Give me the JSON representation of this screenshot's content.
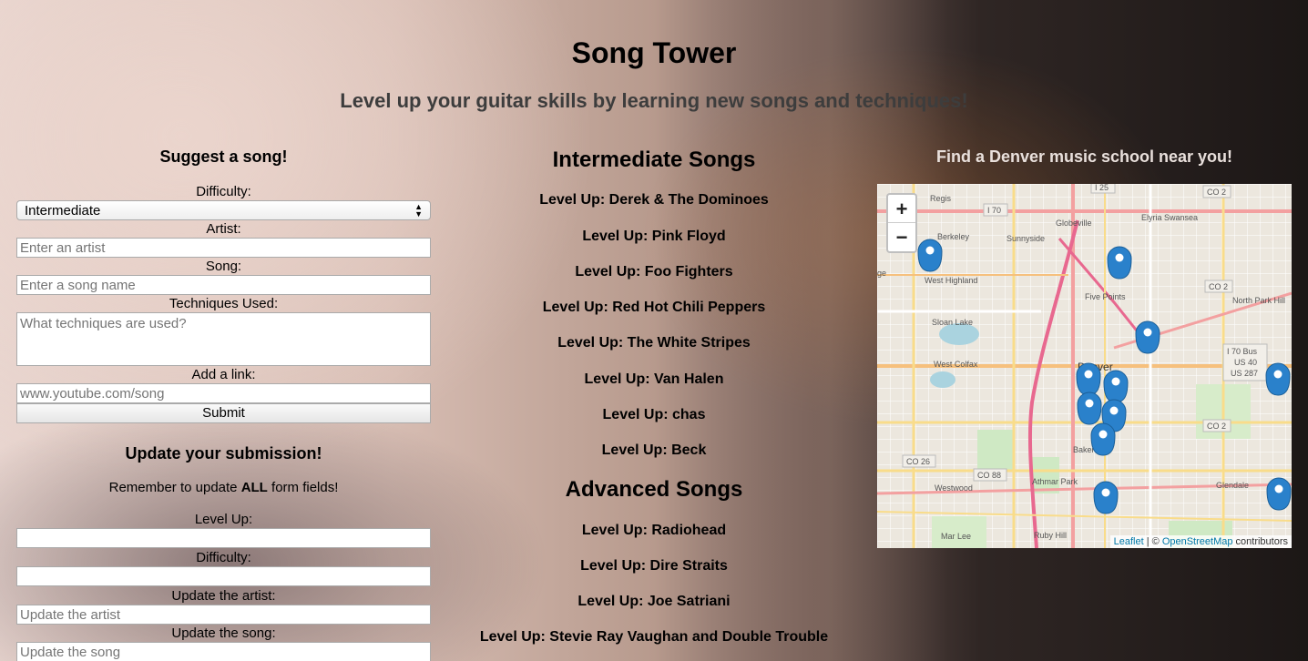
{
  "header": {
    "title": "Song Tower",
    "subtitle": "Level up your guitar skills by learning new songs and techniques!"
  },
  "suggest_form": {
    "heading": "Suggest a song!",
    "difficulty_label": "Difficulty:",
    "difficulty_value": "Intermediate",
    "artist_label": "Artist:",
    "artist_placeholder": "Enter an artist",
    "song_label": "Song:",
    "song_placeholder": "Enter a song name",
    "techniques_label": "Techniques Used:",
    "techniques_placeholder": "What techniques are used?",
    "link_label": "Add a link:",
    "link_placeholder": "www.youtube.com/song",
    "submit_label": "Submit"
  },
  "update_form": {
    "heading": "Update your submission!",
    "remember_prefix": "Remember to update ",
    "remember_bold": "ALL",
    "remember_suffix": " form fields!",
    "level_label": "Level Up:",
    "difficulty_label": "Difficulty:",
    "artist_label": "Update the artist:",
    "artist_placeholder": "Update the artist",
    "song_label": "Update the song:",
    "song_placeholder": "Update the song"
  },
  "intermediate": {
    "heading": "Intermediate Songs",
    "songs": [
      "Level Up: Derek & The Dominoes",
      "Level Up: Pink Floyd",
      "Level Up: Foo Fighters",
      "Level Up: Red Hot Chili Peppers",
      "Level Up: The White Stripes",
      "Level Up: Van Halen",
      "Level Up: chas",
      "Level Up: Beck"
    ]
  },
  "advanced": {
    "heading": "Advanced Songs",
    "songs": [
      "Level Up: Radiohead",
      "Level Up: Dire Straits",
      "Level Up: Joe Satriani",
      "Level Up: Stevie Ray Vaughan and Double Trouble"
    ]
  },
  "map": {
    "heading": "Find a Denver music school near you!",
    "zoom_in": "+",
    "zoom_out": "−",
    "attribution_leaflet": "Leaflet",
    "attribution_sep": " | © ",
    "attribution_osm": "OpenStreetMap",
    "attribution_suffix": " contributors",
    "labels": [
      "Regis",
      "I 25",
      "CO 2",
      "I 70",
      "Globeville",
      "Elyria Swansea",
      "Berkeley",
      "Sunnyside",
      "West Highland",
      "Five Points",
      "CO 2",
      "North Park Hill",
      "Sloan Lake",
      "I 70 Bus",
      "US 40",
      "US 287",
      "West Colfax",
      "Denver",
      "CO 2",
      "CO 26",
      "CO 88",
      "Baker",
      "Athmar Park",
      "Westwood",
      "Glendale",
      "Mar Lee",
      "Ruby Hill",
      "ge"
    ],
    "marker_color": "#2a81cb"
  }
}
